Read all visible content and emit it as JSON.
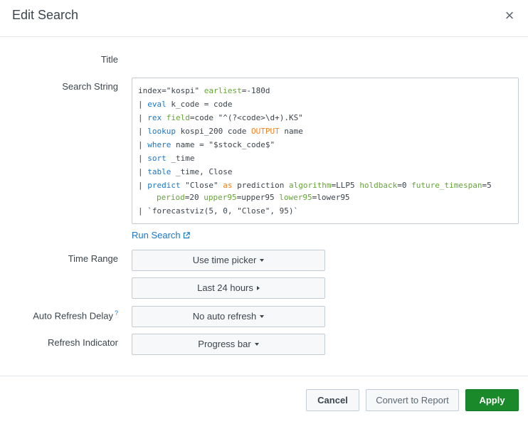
{
  "dialog": {
    "title": "Edit Search",
    "close_symbol": "×"
  },
  "form": {
    "title_label": "Title",
    "search_string_label": "Search String",
    "time_range_label": "Time Range",
    "auto_refresh_label": "Auto Refresh Delay",
    "auto_refresh_help": "?",
    "refresh_indicator_label": "Refresh Indicator"
  },
  "search": {
    "lines": [
      [
        {
          "t": "index=\"kospi\" ",
          "c": "txt"
        },
        {
          "t": "earliest",
          "c": "arg"
        },
        {
          "t": "=-180d",
          "c": "txt"
        }
      ],
      [
        {
          "t": "| ",
          "c": "pipe"
        },
        {
          "t": "eval",
          "c": "cmd"
        },
        {
          "t": " k_code = code",
          "c": "txt"
        }
      ],
      [
        {
          "t": "| ",
          "c": "pipe"
        },
        {
          "t": "rex",
          "c": "cmd"
        },
        {
          "t": " ",
          "c": "txt"
        },
        {
          "t": "field",
          "c": "arg"
        },
        {
          "t": "=code \"^(?<code>\\d+).KS\"",
          "c": "txt"
        }
      ],
      [
        {
          "t": "| ",
          "c": "pipe"
        },
        {
          "t": "lookup",
          "c": "cmd"
        },
        {
          "t": " kospi_200 code ",
          "c": "txt"
        },
        {
          "t": "OUTPUT",
          "c": "kw"
        },
        {
          "t": " name",
          "c": "txt"
        }
      ],
      [
        {
          "t": "| ",
          "c": "pipe"
        },
        {
          "t": "where",
          "c": "cmd"
        },
        {
          "t": " name = \"$stock_code$\"",
          "c": "txt"
        }
      ],
      [
        {
          "t": "| ",
          "c": "pipe"
        },
        {
          "t": "sort",
          "c": "cmd"
        },
        {
          "t": " _time",
          "c": "txt"
        }
      ],
      [
        {
          "t": "| ",
          "c": "pipe"
        },
        {
          "t": "table",
          "c": "cmd"
        },
        {
          "t": " _time, Close",
          "c": "txt"
        }
      ],
      [
        {
          "t": "| ",
          "c": "pipe"
        },
        {
          "t": "predict",
          "c": "cmd"
        },
        {
          "t": " \"Close\" ",
          "c": "txt"
        },
        {
          "t": "as",
          "c": "kw"
        },
        {
          "t": " prediction ",
          "c": "txt"
        },
        {
          "t": "algorithm",
          "c": "arg"
        },
        {
          "t": "=LLP5 ",
          "c": "txt"
        },
        {
          "t": "holdback",
          "c": "arg"
        },
        {
          "t": "=0 ",
          "c": "txt"
        },
        {
          "t": "future_timespan",
          "c": "arg"
        },
        {
          "t": "=5",
          "c": "txt"
        }
      ],
      [
        {
          "t": "period",
          "c": "arg",
          "indent": true
        },
        {
          "t": "=20 ",
          "c": "txt"
        },
        {
          "t": "upper95",
          "c": "arg"
        },
        {
          "t": "=upper95 ",
          "c": "txt"
        },
        {
          "t": "lower95",
          "c": "arg"
        },
        {
          "t": "=lower95",
          "c": "txt"
        }
      ],
      [
        {
          "t": "| `forecastviz(5, 0, \"Close\", 95)`",
          "c": "txt"
        }
      ]
    ]
  },
  "run_search": {
    "label": "Run Search"
  },
  "time_range": {
    "picker_label": "Use time picker",
    "range_label": "Last 24 hours"
  },
  "auto_refresh": {
    "value": "No auto refresh"
  },
  "refresh_indicator": {
    "value": "Progress bar"
  },
  "footer": {
    "cancel_label": "Cancel",
    "convert_label": "Convert to Report",
    "apply_label": "Apply"
  },
  "colors": {
    "link": "#1a77c9",
    "command": "#1a77c9",
    "argument": "#65a637",
    "keyword": "#f58220",
    "apply_bg": "#1a8929"
  }
}
